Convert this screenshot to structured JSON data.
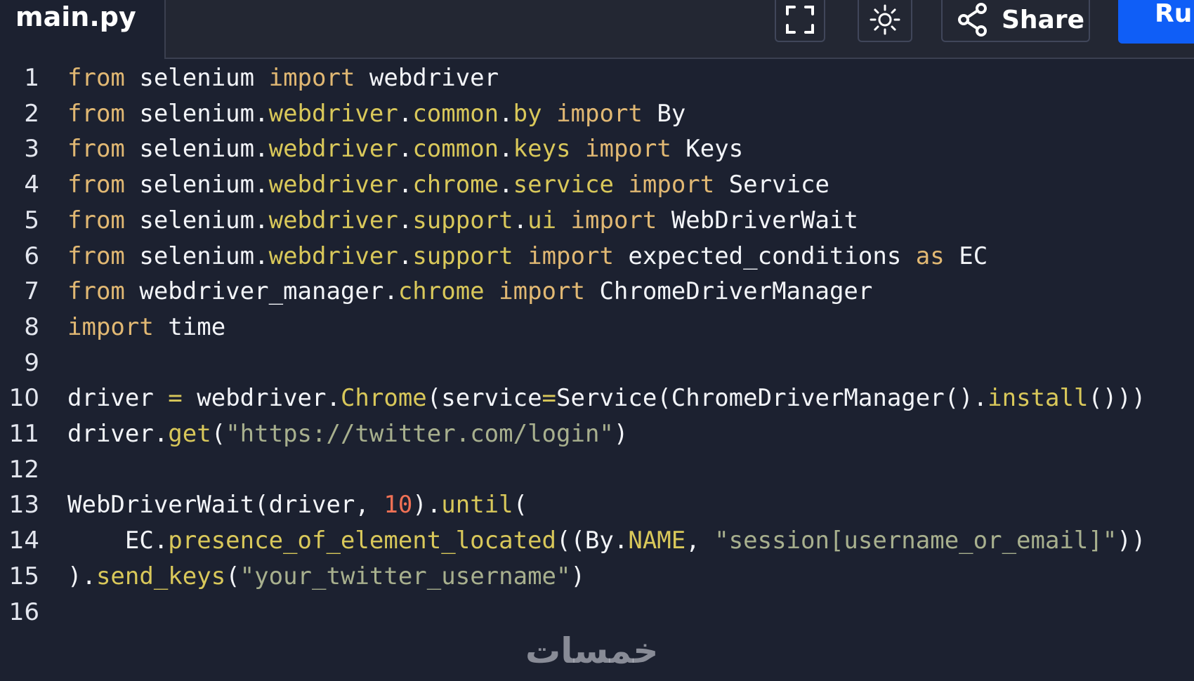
{
  "file_tab": {
    "name": "main.py"
  },
  "toolbar": {
    "fullscreen_icon": "fullscreen-icon",
    "theme_icon": "sun-icon",
    "share_icon": "share-icon",
    "share_label": "Share",
    "run_label": "Run"
  },
  "watermark": {
    "text": "خمسات"
  },
  "colors": {
    "background": "#1c2130",
    "keyword": "#e1b873",
    "attribute": "#d9c85a",
    "string": "#a8b08e",
    "number": "#f07155",
    "run_button": "#0f5ef7"
  },
  "code_lines": [
    {
      "n": "1",
      "tokens": [
        [
          "kw",
          "from"
        ],
        [
          "pl",
          " selenium "
        ],
        [
          "kw",
          "import"
        ],
        [
          "pl",
          " webdriver"
        ]
      ]
    },
    {
      "n": "2",
      "tokens": [
        [
          "kw",
          "from"
        ],
        [
          "pl",
          " selenium."
        ],
        [
          "at",
          "webdriver"
        ],
        [
          "pl",
          "."
        ],
        [
          "at",
          "common"
        ],
        [
          "pl",
          "."
        ],
        [
          "at",
          "by"
        ],
        [
          "pl",
          " "
        ],
        [
          "kw",
          "import"
        ],
        [
          "pl",
          " By"
        ]
      ]
    },
    {
      "n": "3",
      "tokens": [
        [
          "kw",
          "from"
        ],
        [
          "pl",
          " selenium."
        ],
        [
          "at",
          "webdriver"
        ],
        [
          "pl",
          "."
        ],
        [
          "at",
          "common"
        ],
        [
          "pl",
          "."
        ],
        [
          "at",
          "keys"
        ],
        [
          "pl",
          " "
        ],
        [
          "kw",
          "import"
        ],
        [
          "pl",
          " Keys"
        ]
      ]
    },
    {
      "n": "4",
      "tokens": [
        [
          "kw",
          "from"
        ],
        [
          "pl",
          " selenium."
        ],
        [
          "at",
          "webdriver"
        ],
        [
          "pl",
          "."
        ],
        [
          "at",
          "chrome"
        ],
        [
          "pl",
          "."
        ],
        [
          "at",
          "service"
        ],
        [
          "pl",
          " "
        ],
        [
          "kw",
          "import"
        ],
        [
          "pl",
          " Service"
        ]
      ]
    },
    {
      "n": "5",
      "tokens": [
        [
          "kw",
          "from"
        ],
        [
          "pl",
          " selenium."
        ],
        [
          "at",
          "webdriver"
        ],
        [
          "pl",
          "."
        ],
        [
          "at",
          "support"
        ],
        [
          "pl",
          "."
        ],
        [
          "at",
          "ui"
        ],
        [
          "pl",
          " "
        ],
        [
          "kw",
          "import"
        ],
        [
          "pl",
          " WebDriverWait"
        ]
      ]
    },
    {
      "n": "6",
      "tokens": [
        [
          "kw",
          "from"
        ],
        [
          "pl",
          " selenium."
        ],
        [
          "at",
          "webdriver"
        ],
        [
          "pl",
          "."
        ],
        [
          "at",
          "support"
        ],
        [
          "pl",
          " "
        ],
        [
          "kw",
          "import"
        ],
        [
          "pl",
          " expected_conditions "
        ],
        [
          "kw",
          "as"
        ],
        [
          "pl",
          " EC"
        ]
      ]
    },
    {
      "n": "7",
      "tokens": [
        [
          "kw",
          "from"
        ],
        [
          "pl",
          " webdriver_manager."
        ],
        [
          "at",
          "chrome"
        ],
        [
          "pl",
          " "
        ],
        [
          "kw",
          "import"
        ],
        [
          "pl",
          " ChromeDriverManager"
        ]
      ]
    },
    {
      "n": "8",
      "tokens": [
        [
          "kw",
          "import"
        ],
        [
          "pl",
          " time"
        ]
      ]
    },
    {
      "n": "9",
      "tokens": []
    },
    {
      "n": "10",
      "tokens": [
        [
          "pl",
          "driver "
        ],
        [
          "op",
          "="
        ],
        [
          "pl",
          " webdriver."
        ],
        [
          "at",
          "Chrome"
        ],
        [
          "pl",
          "(service"
        ],
        [
          "op",
          "="
        ],
        [
          "pl",
          "Service(ChromeDriverManager()."
        ],
        [
          "at",
          "install"
        ],
        [
          "pl",
          "()))"
        ]
      ]
    },
    {
      "n": "11",
      "tokens": [
        [
          "pl",
          "driver."
        ],
        [
          "at",
          "get"
        ],
        [
          "pl",
          "("
        ],
        [
          "st",
          "\"https://twitter.com/login\""
        ],
        [
          "pl",
          ")"
        ]
      ]
    },
    {
      "n": "12",
      "tokens": []
    },
    {
      "n": "13",
      "tokens": [
        [
          "pl",
          "WebDriverWait(driver, "
        ],
        [
          "nm",
          "10"
        ],
        [
          "pl",
          ")."
        ],
        [
          "at",
          "until"
        ],
        [
          "pl",
          "("
        ]
      ]
    },
    {
      "n": "14",
      "tokens": [
        [
          "pl",
          "    EC."
        ],
        [
          "at",
          "presence_of_element_located"
        ],
        [
          "pl",
          "((By."
        ],
        [
          "at",
          "NAME"
        ],
        [
          "pl",
          ", "
        ],
        [
          "st",
          "\"session[username_or_email]\""
        ],
        [
          "pl",
          "))"
        ]
      ]
    },
    {
      "n": "15",
      "tokens": [
        [
          "pl",
          ")."
        ],
        [
          "at",
          "send_keys"
        ],
        [
          "pl",
          "("
        ],
        [
          "st",
          "\"your_twitter_username\""
        ],
        [
          "pl",
          ")"
        ]
      ]
    },
    {
      "n": "16",
      "tokens": []
    }
  ]
}
